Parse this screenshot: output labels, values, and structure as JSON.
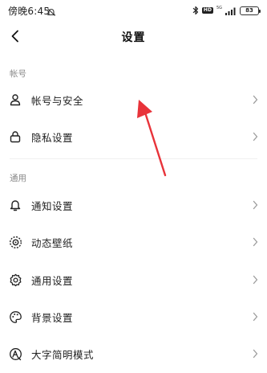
{
  "status_bar": {
    "time": "傍晚6:45",
    "hd": "HD",
    "network": "5G",
    "battery": "83"
  },
  "header": {
    "title": "设置"
  },
  "sections": [
    {
      "label": "帐号",
      "items": [
        {
          "label": "帐号与安全",
          "icon": "person-icon"
        },
        {
          "label": "隐私设置",
          "icon": "lock-icon"
        }
      ]
    },
    {
      "label": "通用",
      "items": [
        {
          "label": "通知设置",
          "icon": "bell-icon"
        },
        {
          "label": "动态壁纸",
          "icon": "wallpaper-icon"
        },
        {
          "label": "通用设置",
          "icon": "gear-icon"
        },
        {
          "label": "背景设置",
          "icon": "palette-icon"
        },
        {
          "label": "大字简明模式",
          "icon": "font-size-icon"
        }
      ]
    }
  ],
  "colors": {
    "annotation_arrow": "#e8333a",
    "section_label": "#8a8a8a",
    "divider": "#f0f0f0"
  }
}
